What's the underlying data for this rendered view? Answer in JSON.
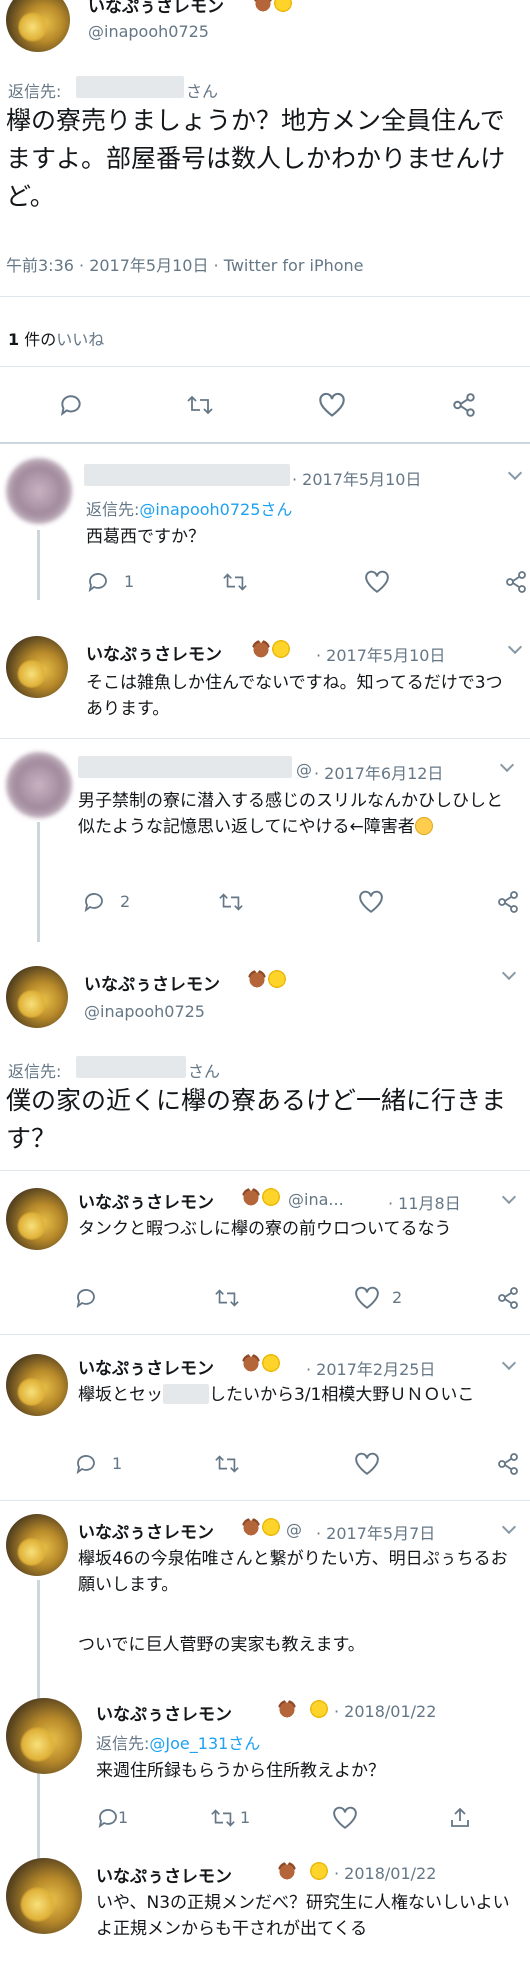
{
  "main_tweet": {
    "name": "いなぷぅさレモン",
    "handle": "@inapooh0725",
    "reply_prefix": "返信先:",
    "reply_suffix": "さん",
    "text": "欅の寮売りましょうか？地方メン全員住んでますよ。部屋番号は数人しかわかりませんけど。",
    "timestamp": "午前3:36 · 2017年5月10日 · Twitter for iPhone",
    "likes_count": "1",
    "likes_label_pre": "件の",
    "likes_label_link": "いいね"
  },
  "replies": [
    {
      "date": "· 2017年5月10日",
      "reply_prefix": "返信先:",
      "reply_handle": "@inapooh0725さん",
      "text": "西葛西ですか？",
      "reply_count": "1"
    },
    {
      "name": "いなぷぅさレモン",
      "date": "· 2017年5月10日",
      "text": "そこは雑魚しか住んでないですね。知ってるだけで3つあります。"
    },
    {
      "date": "· 2017年6月12日",
      "at": "@",
      "text": "男子禁制の寮に潜入する感じのスリルなんかひしひしと似たような記憶思い返してにやける←障害者",
      "reply_count": "2"
    }
  ],
  "second_tweet": {
    "name": "いなぷぅさレモン",
    "handle": "@inapooh0725",
    "reply_prefix": "返信先:",
    "reply_suffix": "さん",
    "text": "僕の家の近くに欅の寮あるけど一緒に行きます？"
  },
  "more_tweets": [
    {
      "name": "いなぷぅさレモン",
      "handle": "@ina...",
      "date": "· 11月8日",
      "text": "タンクと暇つぶしに欅の寮の前ウロついてるなう",
      "like_count": "2"
    },
    {
      "name": "いなぷぅさレモン",
      "date": "· 2017年2月25日",
      "text_a": "欅坂とセッ",
      "text_b": "したいから3/1相模大野ＵＮＯいこ",
      "reply_count": "1"
    },
    {
      "name": "いなぷぅさレモン",
      "at": "@",
      "date": "· 2017年5月7日",
      "text": "欅坂46の今泉佑唯さんと繋がりたい方、明日ぷぅちるお願いします。",
      "text2": "ついでに巨人菅野の実家も教えます。"
    },
    {
      "name": "いなぷぅさレモン",
      "date": "· 2018/01/22",
      "reply_prefix": "返信先:",
      "reply_handle": "@Joe_131さん",
      "text": "来週住所録もらうから住所教えよか？",
      "reply_count": "1",
      "rt_count": "1"
    },
    {
      "name": "いなぷぅさレモン",
      "date": "· 2018/01/22",
      "text": "いや、N3の正規メンだべ？研究生に人権ないしいよいよ正規メンからも干されが出てくる"
    }
  ]
}
